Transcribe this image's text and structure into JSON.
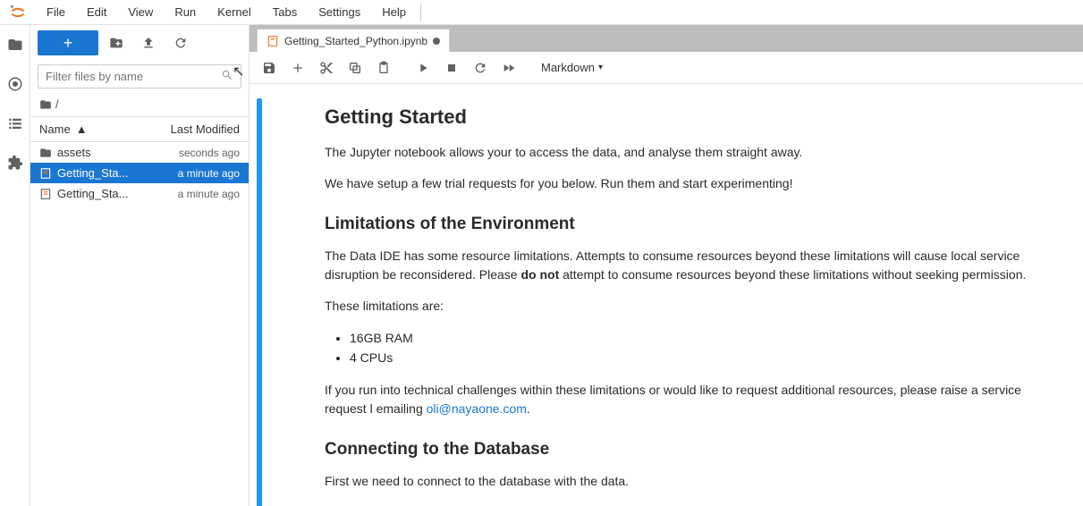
{
  "menu": [
    "File",
    "Edit",
    "View",
    "Run",
    "Kernel",
    "Tabs",
    "Settings",
    "Help"
  ],
  "sidebar": {
    "filter_placeholder": "Filter files by name",
    "breadcrumb_sep": "/",
    "header_name": "Name",
    "header_modified": "Last Modified",
    "rows": [
      {
        "name": "assets",
        "modified": "seconds ago",
        "type": "folder"
      },
      {
        "name": "Getting_Sta...",
        "modified": "a minute ago",
        "type": "notebook",
        "selected": true
      },
      {
        "name": "Getting_Sta...",
        "modified": "a minute ago",
        "type": "notebook"
      }
    ]
  },
  "tab": {
    "title": "Getting_Started_Python.ipynb"
  },
  "cell_type": "Markdown",
  "doc": {
    "h1": "Getting Started",
    "p1": "The Jupyter notebook allows your to access the data, and analyse them straight away.",
    "p2": "We have setup a few trial requests for you below. Run them and start experimenting!",
    "h2": "Limitations of the Environment",
    "p3a": "The Data IDE has some resource limitations. Attempts to consume resources beyond these limitations will cause local service disruption be reconsidered. Please ",
    "p3bold": "do not",
    "p3b": " attempt to consume resources beyond these limitations without seeking permission.",
    "p4": "These limitations are:",
    "li1": "16GB RAM",
    "li2": "4 CPUs",
    "p5a": "If you run into technical challenges within these limitations or would like to request additional resources, please raise a service request l emailing ",
    "p5link": "oli@nayaone.com",
    "p5b": ".",
    "h3": "Connecting to the Database",
    "p6": "First we need to connect to the database with the data."
  }
}
